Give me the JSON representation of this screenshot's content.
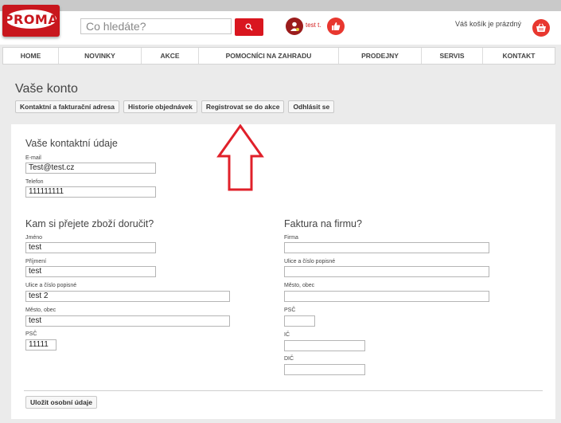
{
  "header": {
    "logo_text": "PROMA",
    "search_placeholder": "Co hledáte?",
    "user_name": "test t.",
    "cart_text": "Váš košík je prázdný"
  },
  "nav": {
    "items": [
      {
        "label": "HOME"
      },
      {
        "label": "NOVINKY"
      },
      {
        "label": "AKCE"
      },
      {
        "label": "POMOCNÍCI NA ZAHRADU"
      },
      {
        "label": "PRODEJNY"
      },
      {
        "label": "SERVIS"
      },
      {
        "label": "KONTAKT"
      }
    ]
  },
  "page": {
    "title": "Vaše konto",
    "tabs": [
      {
        "label": "Kontaktní a fakturační adresa"
      },
      {
        "label": "Historie objednávek"
      },
      {
        "label": "Registrovat se do akce"
      },
      {
        "label": "Odhlásit se"
      }
    ]
  },
  "contact": {
    "title": "Vaše kontaktní údaje",
    "email_label": "E-mail",
    "email_value": "Test@test.cz",
    "phone_label": "Telefon",
    "phone_value": "111111111"
  },
  "delivery": {
    "title": "Kam si přejete zboží doručit?",
    "first_name_label": "Jméno",
    "first_name_value": "test",
    "last_name_label": "Příjmení",
    "last_name_value": "test",
    "street_label": "Ulice a číslo popisné",
    "street_value": "test 2",
    "city_label": "Město, obec",
    "city_value": "test",
    "zip_label": "PSČ",
    "zip_value": "11111"
  },
  "invoice": {
    "title": "Faktura na firmu?",
    "company_label": "Firma",
    "company_value": "",
    "street_label": "Ulice a číslo popisné",
    "street_value": "",
    "city_label": "Město, obec",
    "city_value": "",
    "zip_label": "PSČ",
    "zip_value": "",
    "ic_label": "IČ",
    "ic_value": "",
    "dic_label": "DIČ",
    "dic_value": ""
  },
  "actions": {
    "save_label": "Uložit osobní údaje"
  },
  "colors": {
    "brand_red": "#d9161f",
    "arrow_red": "#e0202a"
  }
}
